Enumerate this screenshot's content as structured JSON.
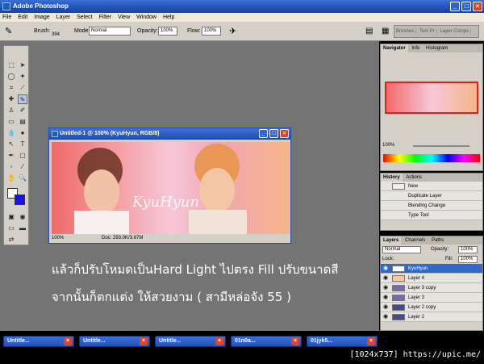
{
  "app": {
    "title": "Adobe Photoshop"
  },
  "menu": [
    "File",
    "Edit",
    "Image",
    "Layer",
    "Select",
    "Filter",
    "View",
    "Window",
    "Help"
  ],
  "options": {
    "brush_label": "Brush:",
    "brush_size": "394",
    "mode_label": "Mode:",
    "mode_value": "Normal",
    "opacity_label": "Opacity:",
    "opacity_value": "100%",
    "flow_label": "Flow:",
    "flow_value": "100%"
  },
  "well_tabs": [
    "Brushes",
    "Tool Pr",
    "Layer Comps"
  ],
  "document": {
    "title": "Untitled-1 @ 100% (KyuHyun, RGB/8)",
    "zoom": "100%",
    "doc_size": "Doc: 293.0K/3.67M",
    "art_text": "KyuHyun"
  },
  "caption": {
    "line1": "แล้วก็ปรับโหมดเป็นHard Light ไปตรง Fill ปรับขนาดสี",
    "line2": "จากนั้นก็ตกแต่ง ให้สวยงาม ( สามีหล่อจัง  55 )"
  },
  "navigator": {
    "tabs": [
      "Navigator",
      "Info",
      "Histogram"
    ],
    "zoom": "100%"
  },
  "history": {
    "tabs": [
      "History",
      "Actions"
    ],
    "items": [
      "New",
      "Duplicate Layer",
      "Blending Change",
      "Type Tool"
    ]
  },
  "layers": {
    "tabs": [
      "Layers",
      "Channels",
      "Paths"
    ],
    "blend_mode": "Normal",
    "opacity_label": "Opacity:",
    "opacity_value": "100%",
    "lock_label": "Lock:",
    "fill_label": "Fill:",
    "fill_value": "100%",
    "items": [
      "KyuHyun",
      "Layer 4",
      "Layer 3 copy",
      "Layer 3",
      "Layer 2 copy",
      "Layer 2"
    ]
  },
  "taskbar": [
    "Untitle...",
    "Untitle...",
    "Untitle...",
    "01n0a...",
    "01jyk5..."
  ],
  "resolution": "[1024x737] https://upic.me/"
}
